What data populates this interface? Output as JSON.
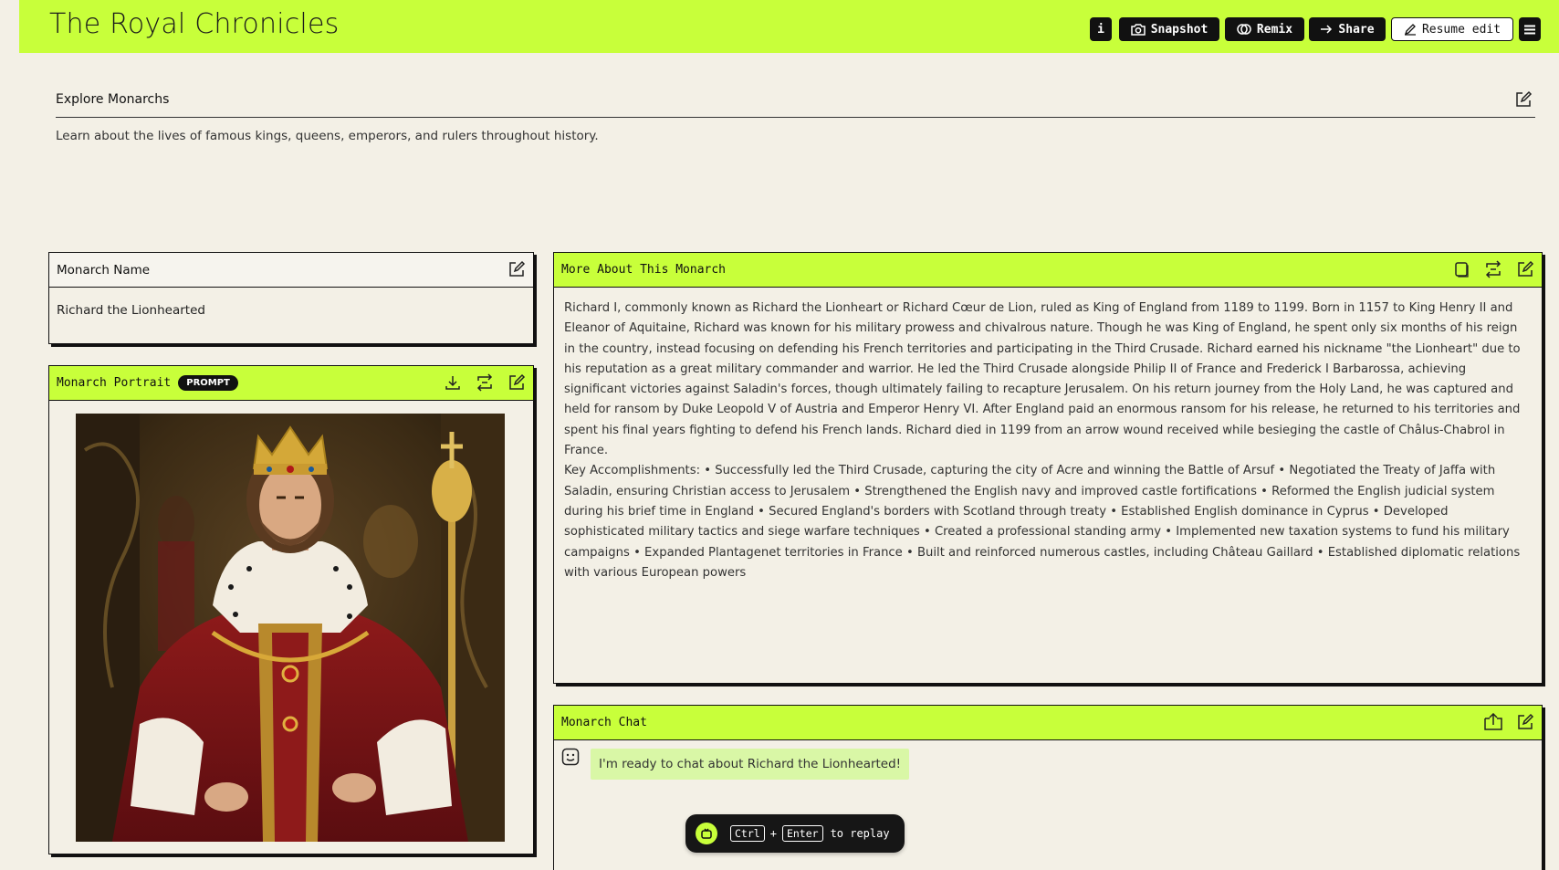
{
  "header": {
    "title": "The Royal Chronicles",
    "buttons": {
      "info": "i",
      "snapshot": "Snapshot",
      "remix": "Remix",
      "share": "Share",
      "resume_edit": "Resume edit"
    }
  },
  "explore": {
    "title": "Explore Monarchs",
    "description": "Learn about the lives of famous kings, queens, emperors, and rulers throughout history."
  },
  "monarch_name": {
    "label": "Monarch Name",
    "value": "Richard the Lionhearted"
  },
  "portrait": {
    "label": "Monarch Portrait",
    "badge": "PROMPT"
  },
  "about": {
    "label": "More About This Monarch",
    "paragraph1": "Richard I, commonly known as Richard the Lionheart or Richard Cœur de Lion, ruled as King of England from 1189 to 1199. Born in 1157 to King Henry II and Eleanor of Aquitaine, Richard was known for his military prowess and chivalrous nature. Though he was King of England, he spent only six months of his reign in the country, instead focusing on defending his French territories and participating in the Third Crusade. Richard earned his nickname \"the Lionheart\" due to his reputation as a great military commander and warrior. He led the Third Crusade alongside Philip II of France and Frederick I Barbarossa, achieving significant victories against Saladin's forces, though ultimately failing to recapture Jerusalem. On his return journey from the Holy Land, he was captured and held for ransom by Duke Leopold V of Austria and Emperor Henry VI. After England paid an enormous ransom for his release, he returned to his territories and spent his final years fighting to defend his French lands. Richard died in 1199 from an arrow wound received while besieging the castle of Châlus-Chabrol in France.",
    "paragraph2": "Key Accomplishments: • Successfully led the Third Crusade, capturing the city of Acre and winning the Battle of Arsuf • Negotiated the Treaty of Jaffa with Saladin, ensuring Christian access to Jerusalem • Strengthened the English navy and improved castle fortifications • Reformed the English judicial system during his brief time in England • Secured England's borders with Scotland through treaty • Established English dominance in Cyprus • Developed sophisticated military tactics and siege warfare techniques • Created a professional standing army • Implemented new taxation systems to fund his military campaigns • Expanded Plantagenet territories in France • Built and reinforced numerous castles, including Château Gaillard • Established diplomatic relations with various European powers"
  },
  "chat": {
    "label": "Monarch Chat",
    "message": "I'm ready to chat about Richard the Lionhearted!"
  },
  "replay": {
    "key1": "Ctrl",
    "plus": "+",
    "key2": "Enter",
    "suffix": "to replay"
  },
  "colors": {
    "accent": "#c8ff3a",
    "background": "#f3f0e6",
    "ink": "#111111",
    "chat_bubble": "#d9f7a6"
  },
  "icons": [
    "info-icon",
    "camera-icon",
    "remix-icon",
    "share-arrow-icon",
    "pencil-icon",
    "menu-icon",
    "edit-icon",
    "download-icon",
    "regenerate-icon",
    "copy-icon",
    "export-icon",
    "bot-face-icon",
    "replay-icon"
  ]
}
